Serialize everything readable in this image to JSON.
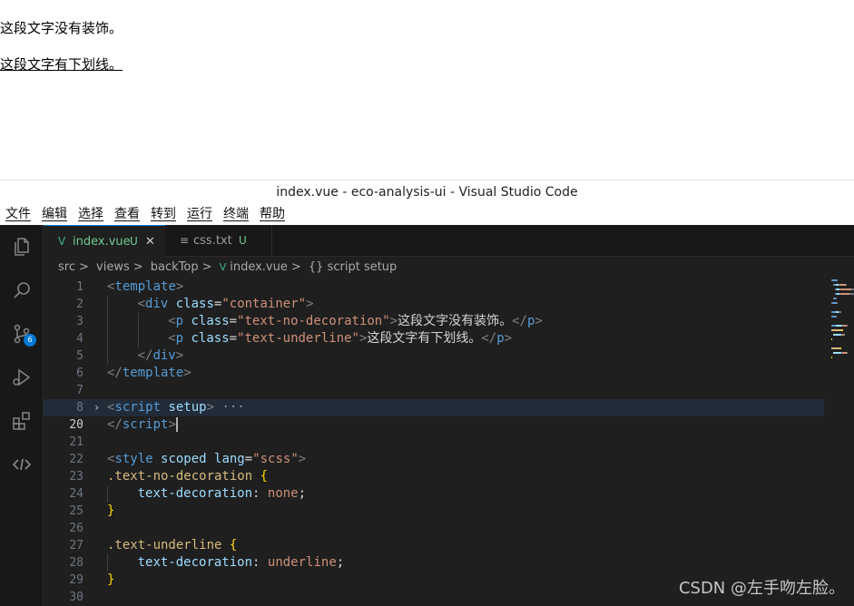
{
  "preview": {
    "para1": "这段文字没有装饰。",
    "para2": "这段文字有下划线。"
  },
  "window": {
    "title": "index.vue - eco-analysis-ui - Visual Studio Code"
  },
  "menu": [
    "文件",
    "编辑",
    "选择",
    "查看",
    "转到",
    "运行",
    "终端",
    "帮助"
  ],
  "activity": {
    "scm_badge": "6"
  },
  "tabs": [
    {
      "label": "index.vue",
      "status": "U",
      "close": "✕",
      "icon": "V"
    },
    {
      "label": "css.txt",
      "status": "U",
      "icon": "≡"
    }
  ],
  "breadcrumb": {
    "items": [
      "src",
      "views",
      "backTop",
      "index.vue",
      "{} script setup"
    ],
    "sep": ">",
    "vue_icon": "V"
  },
  "lines": [
    {
      "n": "1",
      "tokens": [
        [
          "t-punc",
          "<"
        ],
        [
          "t-tag",
          "template"
        ],
        [
          "t-punc",
          ">"
        ]
      ],
      "indent": 0
    },
    {
      "n": "2",
      "tokens": [
        [
          "t-punc",
          "<"
        ],
        [
          "t-tag",
          "div "
        ],
        [
          "t-attr",
          "class"
        ],
        [
          "t-text",
          "="
        ],
        [
          "t-str",
          "\"container\""
        ],
        [
          "t-punc",
          ">"
        ]
      ],
      "indent": 1
    },
    {
      "n": "3",
      "tokens": [
        [
          "t-punc",
          "<"
        ],
        [
          "t-tag",
          "p "
        ],
        [
          "t-attr",
          "class"
        ],
        [
          "t-text",
          "="
        ],
        [
          "t-str",
          "\"text-no-decoration\""
        ],
        [
          "t-punc",
          ">"
        ],
        [
          "t-text",
          "这段文字没有装饰。"
        ],
        [
          "t-punc",
          "</"
        ],
        [
          "t-tag",
          "p"
        ],
        [
          "t-punc",
          ">"
        ]
      ],
      "indent": 2
    },
    {
      "n": "4",
      "tokens": [
        [
          "t-punc",
          "<"
        ],
        [
          "t-tag",
          "p "
        ],
        [
          "t-attr",
          "class"
        ],
        [
          "t-text",
          "="
        ],
        [
          "t-str",
          "\"text-underline\""
        ],
        [
          "t-punc",
          ">"
        ],
        [
          "t-text",
          "这段文字有下划线。"
        ],
        [
          "t-punc",
          "</"
        ],
        [
          "t-tag",
          "p"
        ],
        [
          "t-punc",
          ">"
        ]
      ],
      "indent": 2
    },
    {
      "n": "5",
      "tokens": [
        [
          "t-punc",
          "</"
        ],
        [
          "t-tag",
          "div"
        ],
        [
          "t-punc",
          ">"
        ]
      ],
      "indent": 1
    },
    {
      "n": "6",
      "tokens": [
        [
          "t-punc",
          "</"
        ],
        [
          "t-tag",
          "template"
        ],
        [
          "t-punc",
          ">"
        ]
      ],
      "indent": 0
    },
    {
      "n": "7",
      "tokens": [],
      "indent": 0
    },
    {
      "n": "8",
      "tokens": [
        [
          "t-punc",
          "<"
        ],
        [
          "t-tag",
          "script "
        ],
        [
          "t-attr",
          "setup"
        ],
        [
          "t-punc",
          ">"
        ],
        [
          "t-dots",
          " ···"
        ]
      ],
      "indent": 0,
      "fold": "›",
      "hl": true
    },
    {
      "n": "20",
      "tokens": [
        [
          "t-punc",
          "</"
        ],
        [
          "t-tag",
          "script"
        ],
        [
          "t-punc",
          ">"
        ]
      ],
      "indent": 0,
      "cursor": true,
      "cur": true
    },
    {
      "n": "21",
      "tokens": [],
      "indent": 0
    },
    {
      "n": "22",
      "tokens": [
        [
          "t-punc",
          "<"
        ],
        [
          "t-tag",
          "style "
        ],
        [
          "t-attr",
          "scoped lang"
        ],
        [
          "t-text",
          "="
        ],
        [
          "t-str",
          "\"scss\""
        ],
        [
          "t-punc",
          ">"
        ]
      ],
      "indent": 0
    },
    {
      "n": "23",
      "tokens": [
        [
          "t-sel",
          ".text-no-decoration "
        ],
        [
          "t-brace",
          "{"
        ]
      ],
      "indent": 0
    },
    {
      "n": "24",
      "tokens": [
        [
          "t-prop",
          "text-decoration"
        ],
        [
          "t-text",
          ": "
        ],
        [
          "t-val",
          "none"
        ],
        [
          "t-text",
          ";"
        ]
      ],
      "indent": 1
    },
    {
      "n": "25",
      "tokens": [
        [
          "t-brace",
          "}"
        ]
      ],
      "indent": 0
    },
    {
      "n": "26",
      "tokens": [],
      "indent": 0
    },
    {
      "n": "27",
      "tokens": [
        [
          "t-sel",
          ".text-underline "
        ],
        [
          "t-brace",
          "{"
        ]
      ],
      "indent": 0
    },
    {
      "n": "28",
      "tokens": [
        [
          "t-prop",
          "text-decoration"
        ],
        [
          "t-text",
          ": "
        ],
        [
          "t-val",
          "underline"
        ],
        [
          "t-text",
          ";"
        ]
      ],
      "indent": 1
    },
    {
      "n": "29",
      "tokens": [
        [
          "t-brace",
          "}"
        ]
      ],
      "indent": 0
    },
    {
      "n": "30",
      "tokens": [],
      "indent": 0
    }
  ],
  "watermark": "CSDN @左手吻左脸。"
}
